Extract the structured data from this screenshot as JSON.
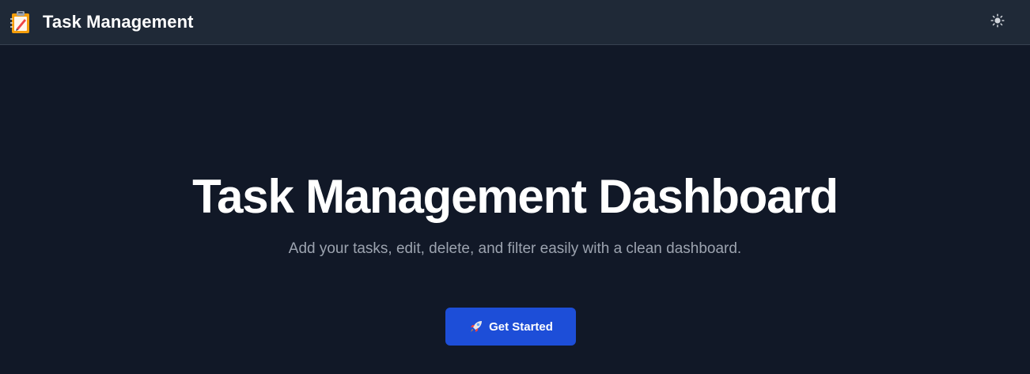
{
  "navbar": {
    "brand_icon": "clipboard-icon",
    "title": "Task Management",
    "theme_toggle_icon": "sun-icon"
  },
  "hero": {
    "title": "Task Management Dashboard",
    "subtitle": "Add your tasks, edit, delete, and filter easily with a clean dashboard.",
    "cta_icon": "rocket-icon",
    "cta_label": "Get Started"
  },
  "colors": {
    "page_background": "#111827",
    "navbar_background": "#1f2937",
    "accent": "#1d4ed8",
    "subtitle_text": "#9ca3af"
  }
}
